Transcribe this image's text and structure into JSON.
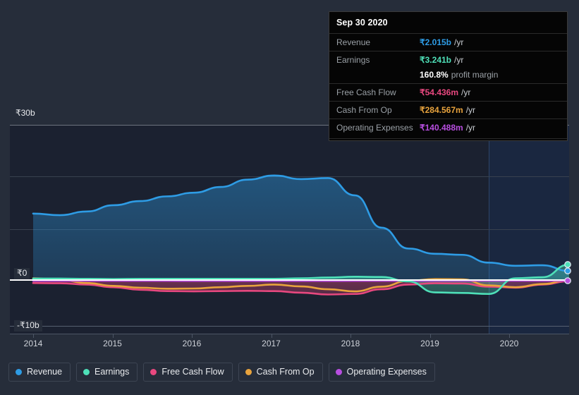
{
  "tooltip": {
    "date": "Sep 30 2020",
    "rows": [
      {
        "label": "Revenue",
        "value": "₹2.015b",
        "unit": "/yr",
        "color": "#2e9ce5"
      },
      {
        "label": "Earnings",
        "value": "₹3.241b",
        "unit": "/yr",
        "color": "#4ee0b8"
      },
      {
        "label": "",
        "value": "160.8%",
        "unit": "",
        "sub": "profit margin",
        "color": "#ffffff"
      },
      {
        "label": "Free Cash Flow",
        "value": "₹54.436m",
        "unit": "/yr",
        "color": "#e8487f"
      },
      {
        "label": "Cash From Op",
        "value": "₹284.567m",
        "unit": "/yr",
        "color": "#e8a33d"
      },
      {
        "label": "Operating Expenses",
        "value": "₹140.488m",
        "unit": "/yr",
        "color": "#b84ee0"
      }
    ]
  },
  "legend": {
    "items": [
      {
        "label": "Revenue",
        "color": "#2e9ce5"
      },
      {
        "label": "Earnings",
        "color": "#4ee0b8"
      },
      {
        "label": "Free Cash Flow",
        "color": "#e8487f"
      },
      {
        "label": "Cash From Op",
        "color": "#e8a33d"
      },
      {
        "label": "Operating Expenses",
        "color": "#b84ee0"
      }
    ]
  },
  "axes": {
    "y_labels": [
      {
        "text": "₹30b"
      },
      {
        "text": "₹0"
      },
      {
        "text": "-₹10b"
      }
    ],
    "x_labels": [
      "2014",
      "2015",
      "2016",
      "2017",
      "2018",
      "2019",
      "2020"
    ]
  },
  "chart_data": {
    "type": "area",
    "title": "",
    "xlabel": "",
    "ylabel": "",
    "ylim": [
      -10,
      30
    ],
    "y_ticks": [
      30,
      0,
      -10
    ],
    "y_tick_labels": [
      "₹30b",
      "₹0",
      "-₹10b"
    ],
    "x_tick_labels": [
      "2014",
      "2015",
      "2016",
      "2017",
      "2018",
      "2019",
      "2020"
    ],
    "x_range": [
      "2013-10",
      "2020-12"
    ],
    "currency": "INR",
    "units": "billions",
    "grid": true,
    "legend_position": "bottom",
    "forecast_start": "2019-12",
    "x": [
      "2014.0",
      "2014.3",
      "2014.6",
      "2015.0",
      "2015.3",
      "2015.6",
      "2016.0",
      "2016.3",
      "2016.6",
      "2017.0",
      "2017.3",
      "2017.6",
      "2018.0",
      "2018.3",
      "2018.6",
      "2019.0",
      "2019.3",
      "2019.6",
      "2020.0",
      "2020.3",
      "2020.75"
    ],
    "series": [
      {
        "name": "Revenue",
        "color": "#2e9ce5",
        "filled": true,
        "values": [
          13.0,
          12.7,
          13.4,
          14.6,
          15.4,
          16.3,
          17.0,
          18.1,
          19.5,
          20.3,
          19.6,
          19.8,
          16.5,
          10.3,
          6.3,
          5.3,
          5.1,
          3.6,
          3.0,
          3.1,
          2.015
        ]
      },
      {
        "name": "Earnings",
        "color": "#4ee0b8",
        "filled": true,
        "values": [
          0.55,
          0.55,
          0.5,
          0.45,
          0.5,
          0.5,
          0.5,
          0.5,
          0.5,
          0.5,
          0.6,
          0.75,
          0.9,
          0.85,
          0.0,
          -2.1,
          -2.2,
          -2.4,
          0.6,
          0.8,
          3.241
        ]
      },
      {
        "name": "Free Cash Flow",
        "color": "#e8487f",
        "filled": true,
        "values": [
          -0.3,
          -0.35,
          -0.6,
          -1.1,
          -1.6,
          -1.85,
          -1.9,
          -1.85,
          -1.8,
          -1.85,
          -2.15,
          -2.5,
          -2.4,
          -1.5,
          -0.6,
          -0.35,
          -0.4,
          -1.0,
          -1.2,
          -0.6,
          0.054
        ]
      },
      {
        "name": "Cash From Op",
        "color": "#e8a33d",
        "filled": false,
        "values": [
          0.6,
          0.3,
          -0.3,
          -0.85,
          -1.2,
          -1.4,
          -1.35,
          -1.1,
          -0.85,
          -0.6,
          -0.95,
          -1.5,
          -1.9,
          -1.0,
          0.1,
          0.45,
          0.4,
          -0.75,
          -1.1,
          -0.5,
          0.285
        ]
      },
      {
        "name": "Operating Expenses",
        "color": "#b84ee0",
        "filled": false,
        "values": [
          0.12,
          0.12,
          0.12,
          0.12,
          0.12,
          0.12,
          0.1,
          0.1,
          0.1,
          0.1,
          0.1,
          0.1,
          0.12,
          0.12,
          0.12,
          0.14,
          0.14,
          0.14,
          0.14,
          0.14,
          0.14
        ]
      }
    ],
    "endpoints": [
      {
        "name": "Earnings",
        "color": "#4ee0b8",
        "value": 3.241
      },
      {
        "name": "Revenue",
        "color": "#2e9ce5",
        "value": 2.015
      },
      {
        "name": "Operating Expenses",
        "color": "#b84ee0",
        "value": 0.14
      }
    ]
  }
}
